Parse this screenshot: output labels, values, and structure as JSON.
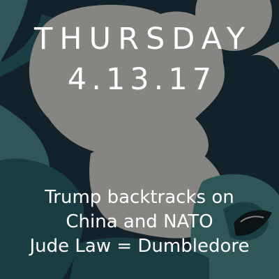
{
  "header": {
    "day": "THURSDAY",
    "date": "4.13.17"
  },
  "headlines": [
    "Trump backtracks on",
    "China and NATO",
    "Jude Law = Dumbledore"
  ],
  "colors": {
    "background": "#13212a",
    "grey": "#868581",
    "teal": "#2f5758",
    "dark_teal": "#1a3d44",
    "text": "#ffffff"
  }
}
